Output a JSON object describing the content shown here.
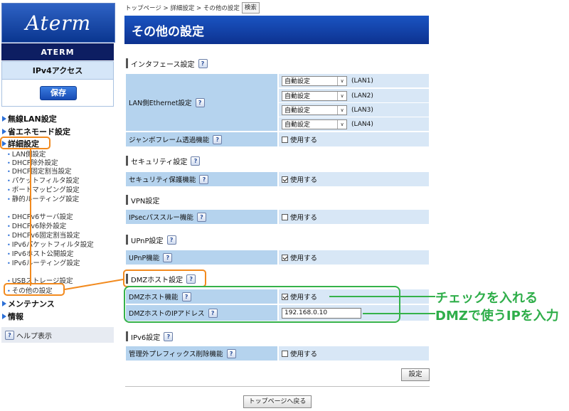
{
  "sidebar": {
    "logo": "Aterm",
    "product": "ATERM",
    "mode": "IPv4アクセス",
    "save_label": "保存",
    "menu": {
      "wireless": "無線LAN設定",
      "eco": "省エネモード設定",
      "advanced": "詳細設定",
      "maintenance": "メンテナンス",
      "info": "情報"
    },
    "sub_items": [
      "LAN側設定",
      "DHCP除外設定",
      "DHCP固定割当設定",
      "パケットフィルタ設定",
      "ポートマッピング設定",
      "静的ルーティング設定",
      "DHCPv6サーバ設定",
      "DHCPv6除外設定",
      "DHCPv6固定割当設定",
      "IPv6パケットフィルタ設定",
      "IPv6ホスト公開設定",
      "IPv6ルーティング設定",
      "USBストレージ設定",
      "その他の設定"
    ],
    "help_label": "ヘルプ表示"
  },
  "breadcrumb": {
    "text": "トップページ > 詳細設定 > その他の設定",
    "search_label": "検索"
  },
  "page_title": "その他の設定",
  "sections": {
    "interface": {
      "title": "インタフェース設定",
      "lan_label": "LAN側Ethernet設定",
      "lan_ports": [
        {
          "value": "自動設定",
          "port": "(LAN1)"
        },
        {
          "value": "自動設定",
          "port": "(LAN2)"
        },
        {
          "value": "自動設定",
          "port": "(LAN3)"
        },
        {
          "value": "自動設定",
          "port": "(LAN4)"
        }
      ],
      "jumbo_label": "ジャンボフレーム透過機能",
      "jumbo_check": "使用する"
    },
    "security": {
      "title": "セキュリティ設定",
      "protect_label": "セキュリティ保護機能",
      "protect_check": "使用する"
    },
    "vpn": {
      "title": "VPN設定",
      "ipsec_label": "IPsecパススルー機能",
      "ipsec_check": "使用する"
    },
    "upnp": {
      "title": "UPnP設定",
      "upnp_label": "UPnP機能",
      "upnp_check": "使用する"
    },
    "dmz": {
      "title": "DMZホスト設定",
      "func_label": "DMZホスト機能",
      "func_check": "使用する",
      "ip_label": "DMZホストのIPアドレス",
      "ip_value": "192.168.0.10"
    },
    "ipv6": {
      "title": "IPv6設定",
      "prefix_label": "管理外プレフィックス削除機能",
      "prefix_check": "使用する"
    }
  },
  "buttons": {
    "settings": "設定",
    "top_page": "トップページへ戻る"
  },
  "annotations": {
    "check_note": "チェックを入れる",
    "ip_note": "DMZで使うIPを入力"
  },
  "colors": {
    "accent_blue": "#1a54c2",
    "label_cell": "#b5d3ee",
    "value_cell": "#d8e7f6",
    "annotation_orange": "#f28a1e",
    "annotation_green": "#35b24a"
  },
  "icons": {
    "help": "question-icon",
    "nav_marker": "triangle-right-icon",
    "dropdown": "chevron-down-icon",
    "checkbox": "checkbox-icon"
  }
}
